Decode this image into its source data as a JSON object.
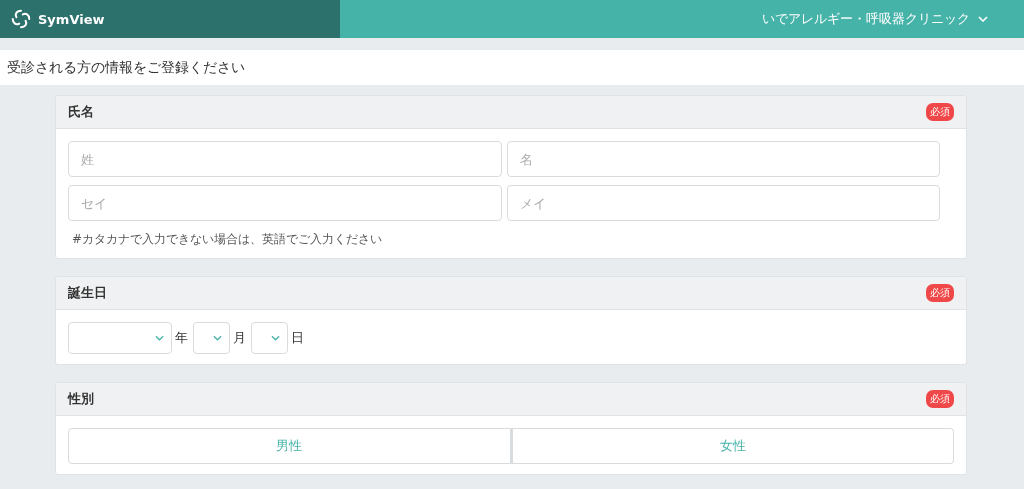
{
  "header": {
    "logo": "SymView",
    "clinic": "いでアレルギー・呼吸器クリニック"
  },
  "page_title": "受診される方の情報をご登録ください",
  "sections": [
    {
      "kind": "name",
      "title": "氏名",
      "required_badge": "必須",
      "fields": [
        {
          "placeholder": "姓"
        },
        {
          "placeholder": "名"
        },
        {
          "placeholder": "セイ"
        },
        {
          "placeholder": "メイ"
        }
      ],
      "note": "#カタカナで入力できない場合は、英語でご入力ください"
    },
    {
      "kind": "date",
      "title": "誕生日",
      "required_badge": "必須",
      "selects": [
        {
          "unit": "年"
        },
        {
          "unit": "月"
        },
        {
          "unit": "日"
        }
      ]
    },
    {
      "kind": "gender",
      "title": "性別",
      "required_badge": "必須",
      "options": [
        {
          "label": "男性",
          "selected": false
        },
        {
          "label": "女性",
          "selected": false
        }
      ]
    }
  ]
}
